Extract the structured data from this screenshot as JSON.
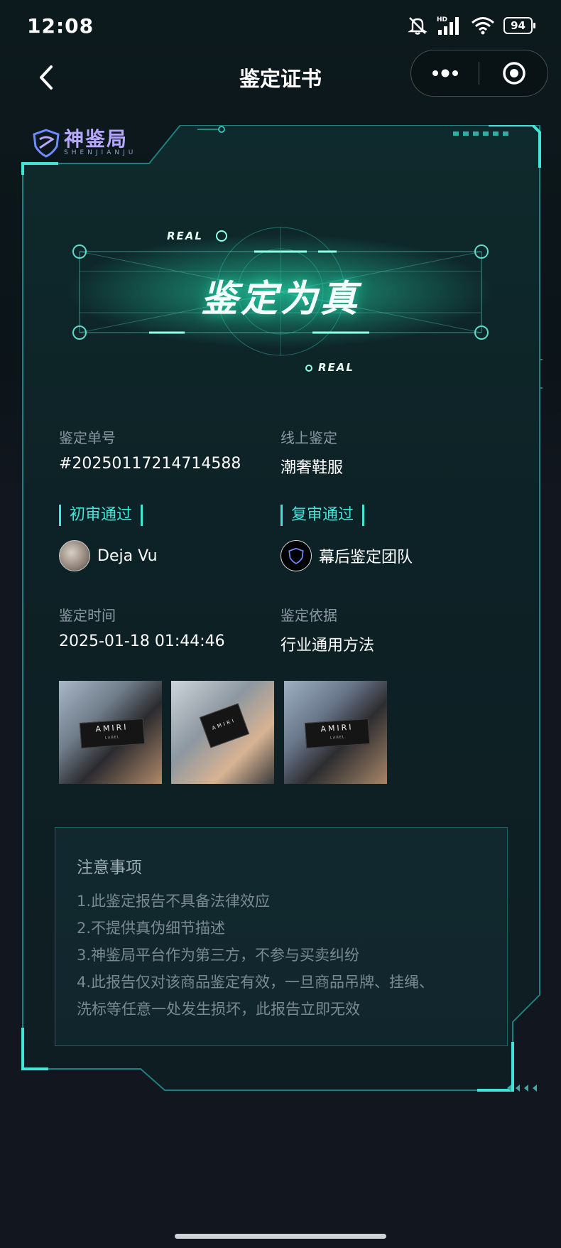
{
  "status_bar": {
    "time": "12:08",
    "battery": "94",
    "network": "HD"
  },
  "nav": {
    "title": "鉴定证书"
  },
  "brand": {
    "name": "神鉴局",
    "sub": "SHENJIANJU"
  },
  "hero": {
    "title": "鉴定为真",
    "badge_top": "REAL",
    "badge_bottom": "REAL"
  },
  "info": {
    "order_label": "鉴定单号",
    "order_value": "#20250117214714588",
    "type_label": "线上鉴定",
    "type_value": "潮奢鞋服",
    "first_review": "初审通过",
    "first_reviewer": "Deja Vu",
    "second_review": "复审通过",
    "second_reviewer": "幕后鉴定团队",
    "time_label": "鉴定时间",
    "time_value": "2025-01-18 01:44:46",
    "basis_label": "鉴定依据",
    "basis_value": "行业通用方法"
  },
  "photos": [
    {
      "tag": "AMIRI",
      "tag_sub": "LABEL"
    },
    {
      "tag": "AMIRI"
    },
    {
      "tag": "AMIRI",
      "tag_sub": "LABEL"
    }
  ],
  "notes": {
    "title": "注意事项",
    "items": [
      "1.此鉴定报告不具备法律效应",
      "2.不提供真伪细节描述",
      "3.神鉴局平台作为第三方，不参与买卖纠纷",
      "4.此报告仅对该商品鉴定有效，一旦商品吊牌、挂绳、",
      "洗标等任意一处发生损坏，此报告立即无效"
    ]
  },
  "colors": {
    "accent": "#3fe6d9",
    "background": "#12161e",
    "brand": "#b6a8ff"
  }
}
